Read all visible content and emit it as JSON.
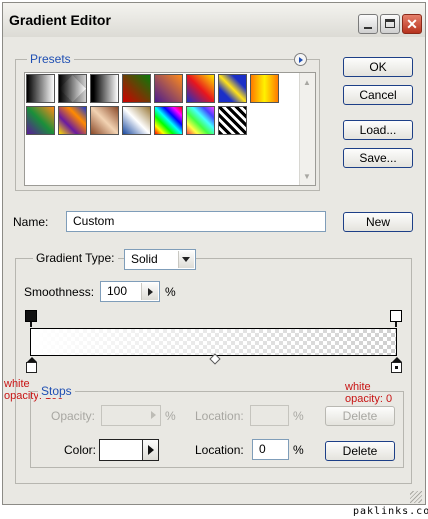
{
  "window": {
    "title": "Gradient Editor"
  },
  "presets": {
    "label": "Presets",
    "swatches": [
      {
        "name": "black-white",
        "css": "linear-gradient(90deg,#000,#fff)"
      },
      {
        "name": "black-transparent",
        "css": "linear-gradient(90deg,#000,rgba(0,0,0,0))"
      },
      {
        "name": "black-white-2",
        "css": "linear-gradient(90deg,#000 10%,#fff)"
      },
      {
        "name": "red-green",
        "css": "linear-gradient(45deg,#d00000,#0a7a0a)"
      },
      {
        "name": "violet-orange",
        "css": "linear-gradient(45deg,#4a1b8f,#ff8c1a)"
      },
      {
        "name": "blue-red-yellow",
        "css": "linear-gradient(45deg,#1b2fc8,#e8161d,#ffe800)"
      },
      {
        "name": "blue-yellow-blue",
        "css": "linear-gradient(45deg,#1b2fc8 25%,#ffe21a 50%,#1b2fc8 75%)"
      },
      {
        "name": "orange-yellow-orange",
        "css": "linear-gradient(90deg,#ff7a00,#fff200,#ff7a00)"
      },
      {
        "name": "violet-green-orange",
        "css": "linear-gradient(45deg,#5a1a9a,#1a8f3a,#ff8a1a)"
      },
      {
        "name": "yellow-violet-orange-blue",
        "css": "linear-gradient(45deg,#ffe000,#6a1aa0,#ff8a00,#1a3ad0)"
      },
      {
        "name": "copper",
        "css": "linear-gradient(45deg,#8a4a2a,#f2d2b2,#8a4a2a)"
      },
      {
        "name": "chrome",
        "css": "linear-gradient(45deg,#1a4aa0,#fff,#9a7a3a)"
      },
      {
        "name": "spectrum",
        "css": "linear-gradient(45deg,#f00,#ff0,#0f0,#0ff,#00f,#f0f,#f00)"
      },
      {
        "name": "transparent-rainbow",
        "css": "linear-gradient(45deg,#f44,#ff4,#4f4,#4ff,#44f,#f4f)"
      },
      {
        "name": "transparent-stripes",
        "css": "repeating-linear-gradient(45deg,#000 0 3px,#fff 3px 6px)"
      }
    ]
  },
  "buttons": {
    "ok": "OK",
    "cancel": "Cancel",
    "load": "Load...",
    "save": "Save...",
    "new": "New"
  },
  "name_field": {
    "label": "Name:",
    "value": "Custom"
  },
  "gradient_type": {
    "label": "Gradient Type:",
    "value": "Solid"
  },
  "smoothness": {
    "label": "Smoothness:",
    "value": "100",
    "unit": "%"
  },
  "annotations": {
    "left": "white\nopacity: 100",
    "right": "white\nopacity: 0"
  },
  "stops": {
    "label": "Stops",
    "opacity_label": "Opacity:",
    "opacity_unit": "%",
    "location_label": "Location:",
    "location_unit": "%",
    "delete_label": "Delete",
    "color_label": "Color:",
    "color_value": "#ffffff",
    "color_location_label": "Location:",
    "color_location_value": "0",
    "color_location_unit": "%",
    "color_delete_label": "Delete"
  },
  "footer": {
    "watermark": "paklinks.com"
  }
}
